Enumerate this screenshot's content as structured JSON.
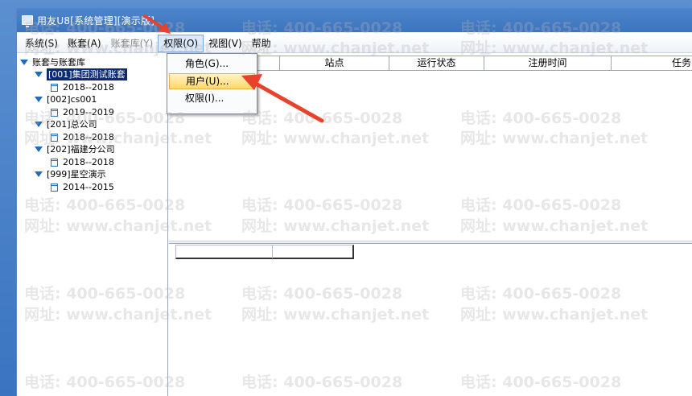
{
  "window": {
    "title": "用友U8[系统管理][演示版]"
  },
  "menubar": {
    "items": [
      {
        "label": "系统(S)"
      },
      {
        "label": "账套(A)"
      },
      {
        "label": "账套库(Y)"
      },
      {
        "label": "权限(O)"
      },
      {
        "label": "视图(V)"
      },
      {
        "label": "帮助"
      }
    ]
  },
  "permission_menu": {
    "items": [
      {
        "label": "角色(G)..."
      },
      {
        "label": "用户(U)..."
      },
      {
        "label": "权限(I)..."
      }
    ]
  },
  "tree": {
    "root": "账套与账套库",
    "nodes": [
      {
        "label": "[001]集团测试账套",
        "child": "2018--2018"
      },
      {
        "label": "[002]cs001",
        "child": "2019--2019"
      },
      {
        "label": "[201]总公司",
        "child": "2018--2018"
      },
      {
        "label": "[202]福建分公司",
        "child": "2018--2018"
      },
      {
        "label": "[999]星空演示",
        "child": "2014--2015"
      }
    ]
  },
  "grid": {
    "columns": [
      "站点",
      "运行状态",
      "注册时间",
      "任务"
    ]
  },
  "watermark": {
    "phone": "电话: 400-665-0028",
    "site": "网址: www.chanjet.net"
  },
  "colors": {
    "title_bar": "#3d74be",
    "selection": "#0b2a73",
    "menu_hover": "#ffd86b",
    "annotation_arrow": "#e8412c"
  }
}
